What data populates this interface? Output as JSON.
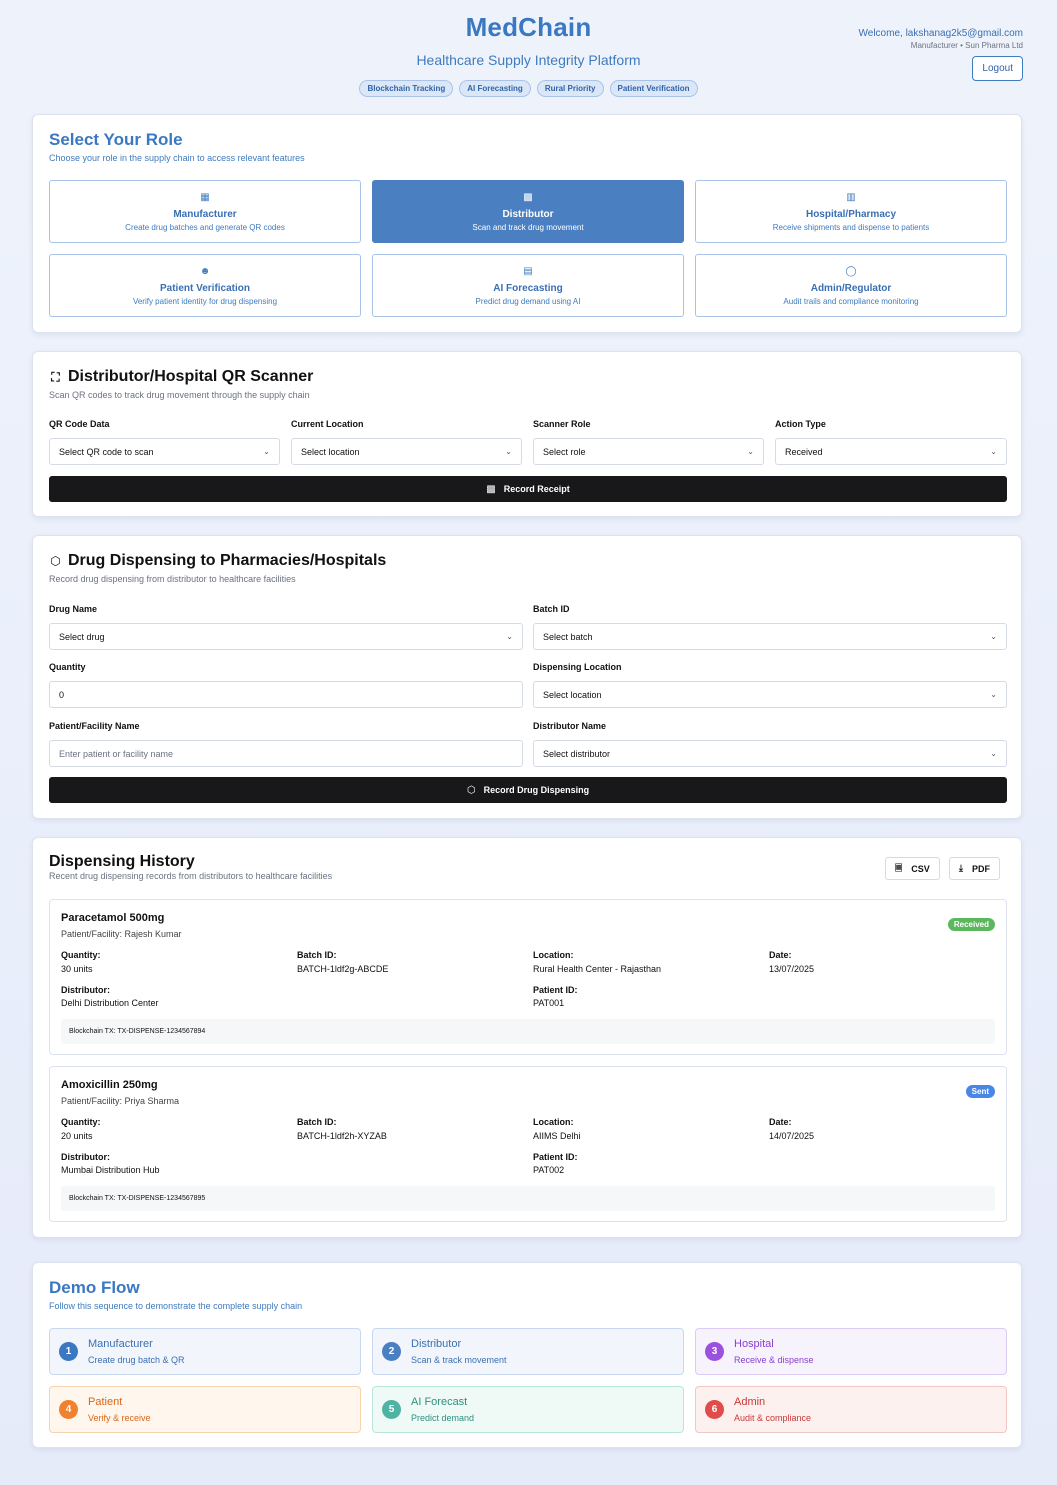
{
  "header": {
    "title": "MedChain",
    "subtitle": "Healthcare Supply Integrity Platform",
    "tags": [
      "Blockchain Tracking",
      "AI Forecasting",
      "Rural Priority",
      "Patient Verification"
    ],
    "welcome": "Welcome, lakshanag2k5@gmail.com",
    "user_role": "Manufacturer • Sun Pharma Ltd",
    "logout_label": "Logout"
  },
  "roles": {
    "title": "Select Your Role",
    "subtitle": "Choose your role in the supply chain to access relevant features",
    "items": [
      {
        "name": "Manufacturer",
        "desc": "Create drug batches and generate QR codes",
        "icon": "building-icon"
      },
      {
        "name": "Distributor",
        "desc": "Scan and track drug movement",
        "icon": "qr-icon",
        "active": true
      },
      {
        "name": "Hospital/Pharmacy",
        "desc": "Receive shipments and dispense to patients",
        "icon": "hospital-icon"
      },
      {
        "name": "Patient Verification",
        "desc": "Verify patient identity for drug dispensing",
        "icon": "users-icon"
      },
      {
        "name": "AI Forecasting",
        "desc": "Predict drug demand using AI",
        "icon": "bar-chart-icon"
      },
      {
        "name": "Admin/Regulator",
        "desc": "Audit trails and compliance monitoring",
        "icon": "shield-icon"
      }
    ]
  },
  "scanner": {
    "title": "Distributor/Hospital QR Scanner",
    "subtitle": "Scan QR codes to track drug movement through the supply chain",
    "fields": [
      {
        "label": "QR Code Data",
        "value": "Select QR code to scan"
      },
      {
        "label": "Current Location",
        "value": "Select location"
      },
      {
        "label": "Scanner Role",
        "value": "Select role"
      },
      {
        "label": "Action Type",
        "value": "Received"
      }
    ],
    "button_label": "Record Receipt"
  },
  "dispensing": {
    "title": "Drug Dispensing to Pharmacies/Hospitals",
    "subtitle": "Record drug dispensing from distributor to healthcare facilities",
    "drug_name_label": "Drug Name",
    "drug_name_value": "Select drug",
    "batch_label": "Batch ID",
    "batch_value": "Select batch",
    "quantity_label": "Quantity",
    "quantity_value": "0",
    "location_label": "Dispensing Location",
    "location_value": "Select location",
    "patient_label": "Patient/Facility Name",
    "patient_placeholder": "Enter patient or facility name",
    "distributor_label": "Distributor Name",
    "distributor_value": "Select distributor",
    "button_label": "Record Drug Dispensing"
  },
  "history": {
    "title": "Dispensing History",
    "subtitle": "Recent drug dispensing records from distributors to healthcare facilities",
    "csv_label": "CSV",
    "pdf_label": "PDF",
    "labels": {
      "quantity": "Quantity:",
      "batch": "Batch ID:",
      "location": "Location:",
      "date": "Date:",
      "distributor": "Distributor:",
      "patient_id": "Patient ID:"
    },
    "records": [
      {
        "drug": "Paracetamol 500mg",
        "patient": "Patient/Facility: Rajesh Kumar",
        "status": "Received",
        "status_color": "#5cb85c",
        "quantity": "30 units",
        "batch": "BATCH-1ldf2g-ABCDE",
        "location": "Rural Health Center - Rajasthan",
        "date": "13/07/2025",
        "distributor": "Delhi Distribution Center",
        "patient_id": "PAT001",
        "tx": "Blockchain TX: TX-DISPENSE-1234567894"
      },
      {
        "drug": "Amoxicillin 250mg",
        "patient": "Patient/Facility: Priya Sharma",
        "status": "Sent",
        "status_color": "#4a86e8",
        "quantity": "20 units",
        "batch": "BATCH-1ldf2h-XYZAB",
        "location": "AIIMS Delhi",
        "date": "14/07/2025",
        "distributor": "Mumbai Distribution Hub",
        "patient_id": "PAT002",
        "tx": "Blockchain TX: TX-DISPENSE-1234567895"
      }
    ]
  },
  "demo": {
    "title": "Demo Flow",
    "subtitle": "Follow this sequence to demonstrate the complete supply chain",
    "steps": [
      {
        "num": "1",
        "name": "Manufacturer",
        "desc": "Create drug batch & QR",
        "accent": "#3a78c2",
        "bg": "#f2f6fc",
        "border": "#c7d8ef",
        "text": "#3a6fb3"
      },
      {
        "num": "2",
        "name": "Distributor",
        "desc": "Scan & track movement",
        "accent": "#4a7fc1",
        "bg": "#f2f6fc",
        "border": "#c7d8ef",
        "text": "#3a6fb3"
      },
      {
        "num": "3",
        "name": "Hospital",
        "desc": "Receive & dispense",
        "accent": "#9b51e0",
        "bg": "#f7f3fd",
        "border": "#dccbf3",
        "text": "#8a3fd0"
      },
      {
        "num": "4",
        "name": "Patient",
        "desc": "Verify & receive",
        "accent": "#f0812f",
        "bg": "#fff7ee",
        "border": "#f6d2ae",
        "text": "#d8671a"
      },
      {
        "num": "5",
        "name": "AI Forecast",
        "desc": "Predict demand",
        "accent": "#4fb3a3",
        "bg": "#effaf7",
        "border": "#b9e6dc",
        "text": "#2f8f7f"
      },
      {
        "num": "6",
        "name": "Admin",
        "desc": "Audit & compliance",
        "accent": "#e04b4b",
        "bg": "#fdf1f0",
        "border": "#f1c7c4",
        "text": "#c93838"
      }
    ]
  }
}
